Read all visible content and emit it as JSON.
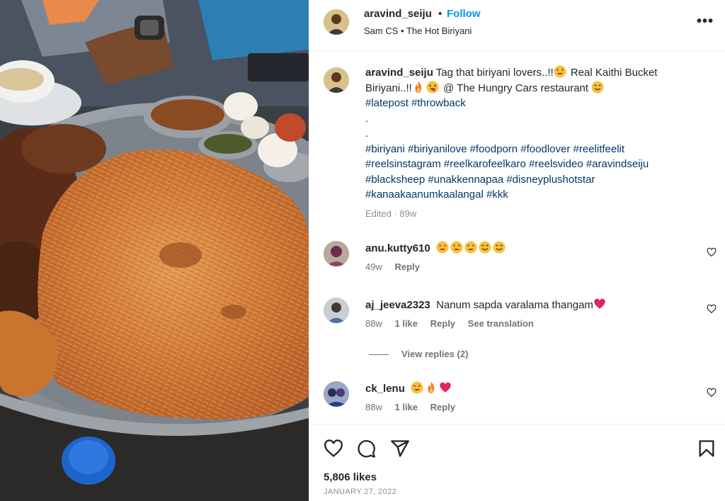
{
  "post": {
    "username": "aravind_seiju",
    "separator": "•",
    "follow_label": "Follow",
    "subtitle": "Sam CS • The Hot Biriyani",
    "more_label": "•••"
  },
  "caption": {
    "username": "aravind_seiju",
    "text_part1": "Tag that biriyani lovers..!!",
    "text_part2": " Real Kaithi Bucket Biriyani..!!",
    "text_part3": " @ The Hungry Cars restaurant ",
    "tags_line1": "#latepost #throwback",
    "dot1": ".",
    "dot2": ".",
    "tags_line2": "#biriyani #biriyanilove #foodporn #foodlover #reelitfeelit #reelsinstagram #reelkarofeelkaro #reelsvideo #aravindseiju #blacksheep #unakkennapaa #disneyplushotstar #kanaakaanumkaalangal #kkk",
    "meta": "Edited · 89w"
  },
  "comments": [
    {
      "username": "anu.kutty610",
      "text": "",
      "emojis": [
        "heart-eyes-emoji",
        "heart-eyes-emoji",
        "heart-eyes-emoji",
        "smile-emoji",
        "smile-emoji"
      ],
      "time": "49w",
      "likes": "",
      "reply": "Reply",
      "translation": ""
    },
    {
      "username": "aj_jeeva2323",
      "text": "Nanum sapda varalama thangam",
      "emojis": [
        "red-heart-emoji"
      ],
      "time": "88w",
      "likes": "1 like",
      "reply": "Reply",
      "translation": "See translation"
    },
    {
      "username": "ck_lenu",
      "text": "",
      "emojis": [
        "heart-eyes-emoji",
        "fire-emoji",
        "red-heart-emoji"
      ],
      "time": "88w",
      "likes": "1 like",
      "reply": "Reply",
      "translation": ""
    }
  ],
  "view_replies": "View replies (2)",
  "actions": {
    "icons": [
      "heart-icon",
      "comment-icon",
      "share-icon",
      "bookmark-icon"
    ],
    "likes": "5,806 likes",
    "date": "JANUARY 27, 2022"
  },
  "colors": {
    "link_blue": "#0095f6",
    "hashtag": "#00376b",
    "secondary": "#737373",
    "rice": "#d9823a",
    "plate": "#8a8f96"
  }
}
